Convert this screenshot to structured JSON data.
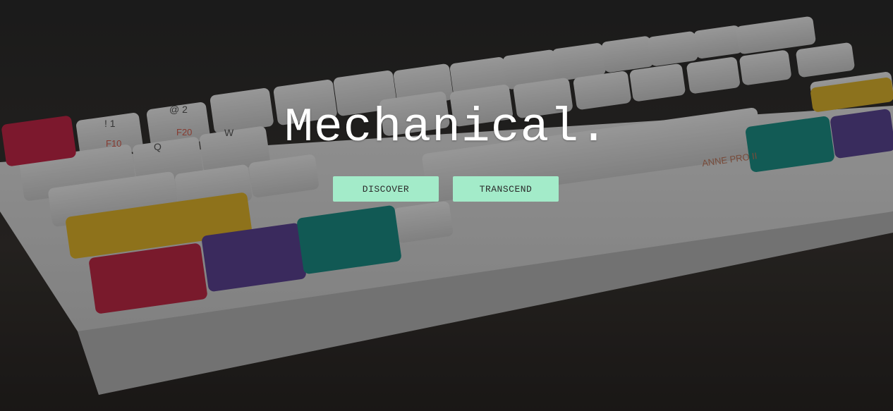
{
  "hero": {
    "title": "Mechanical.",
    "background_image": "keyboard-photo",
    "keyboard_brand_label": "ANNE PRO II"
  },
  "actions": {
    "discover_label": "DISCOVER",
    "transcend_label": "TRANSCEND"
  },
  "colors": {
    "button_bg": "#a3ebc9",
    "title": "#ffffff",
    "key_pink": "#d9304f",
    "key_yellow": "#f0c331",
    "key_purple": "#6b4fa5",
    "key_teal": "#1f9e95",
    "key_white": "#e4e4e4"
  }
}
